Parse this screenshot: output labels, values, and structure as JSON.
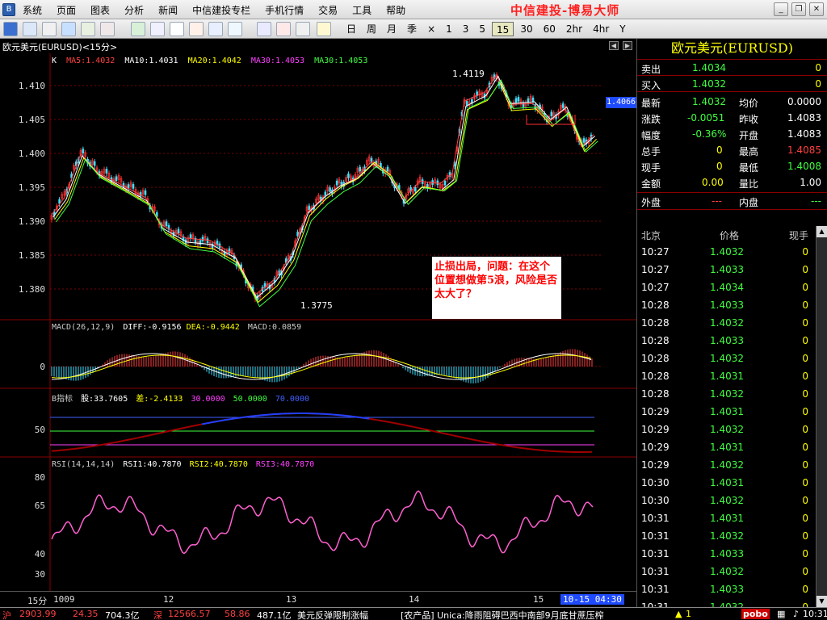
{
  "menu": {
    "items": [
      "系统",
      "页面",
      "图表",
      "分析",
      "新闻",
      "中信建投专栏",
      "手机行情",
      "交易",
      "工具",
      "帮助"
    ],
    "brand": "中信建投-博易大师"
  },
  "toolbar": {
    "periods": [
      "日",
      "周",
      "月",
      "季",
      "×",
      "1",
      "3",
      "5",
      "15",
      "30",
      "60",
      "2hr",
      "4hr",
      "Y"
    ],
    "active_period": "15"
  },
  "chart": {
    "title": "欧元美元(EURUSD)<15分>",
    "price_pane": {
      "legend": [
        {
          "text": "K",
          "color": "#ffffff"
        },
        {
          "text": "MA5:1.4032",
          "color": "#ff4040"
        },
        {
          "text": "MA10:1.4031",
          "color": "#ffffff"
        },
        {
          "text": "MA20:1.4042",
          "color": "#ffff00"
        },
        {
          "text": "MA30:1.4053",
          "color": "#ff40ff"
        },
        {
          "text": "MA30:1.4053",
          "color": "#40ff40"
        }
      ],
      "y_ticks": [
        "1.410",
        "1.405",
        "1.400",
        "1.395",
        "1.390",
        "1.385",
        "1.380"
      ],
      "high_label": "1.4119",
      "low_label": "1.3775",
      "last_price_tag": "1.4066"
    },
    "macd_pane": {
      "legend": [
        {
          "text": "MACD(26,12,9)",
          "color": "#cccccc"
        },
        {
          "text": "DIFF:-0.9156",
          "color": "#ffffff"
        },
        {
          "text": "DEA:-0.9442",
          "color": "#ffff00"
        },
        {
          "text": "MACD:0.0859",
          "color": "#cccccc"
        }
      ],
      "y_ticks": [
        "0"
      ]
    },
    "b_pane": {
      "legend": [
        {
          "text": "B指标",
          "color": "#cccccc"
        },
        {
          "text": "股:33.7605",
          "color": "#ffffff"
        },
        {
          "text": "差:-2.4133",
          "color": "#ffff00"
        },
        {
          "text": "30.0000",
          "color": "#ff40ff"
        },
        {
          "text": "50.0000",
          "color": "#40ff40"
        },
        {
          "text": "70.0000",
          "color": "#4060ff"
        }
      ],
      "y_ticks": [
        "50"
      ]
    },
    "rsi_pane": {
      "legend": [
        {
          "text": "RSI(14,14,14)",
          "color": "#cccccc"
        },
        {
          "text": "RSI1:40.7870",
          "color": "#ffffff"
        },
        {
          "text": "RSI2:40.7870",
          "color": "#ffff00"
        },
        {
          "text": "RSI3:40.7870",
          "color": "#ff40ff"
        }
      ],
      "y_ticks": [
        "80",
        "65",
        "40",
        "30"
      ]
    },
    "note": "止损出局，问题：在这个位置想做第5浪，风险是否太大了？",
    "x_axis": {
      "period_label": "15分",
      "labels": [
        "1009",
        "12",
        "13",
        "14",
        "15"
      ],
      "time_tag": "10-15 04:30"
    }
  },
  "quote": {
    "title": "欧元美元(EURUSD)",
    "sell": {
      "label": "卖出",
      "price": "1.4034",
      "qty": "0"
    },
    "buy": {
      "label": "买入",
      "price": "1.4032",
      "qty": "0"
    },
    "stats": [
      {
        "l1": "最新",
        "v1": "1.4032",
        "c1": "#40ff40",
        "l2": "均价",
        "v2": "0.0000",
        "c2": "#ffffff"
      },
      {
        "l1": "涨跌",
        "v1": "-0.0051",
        "c1": "#40ff40",
        "l2": "昨收",
        "v2": "1.4083",
        "c2": "#ffffff"
      },
      {
        "l1": "幅度",
        "v1": "-0.36%",
        "c1": "#40ff40",
        "l2": "开盘",
        "v2": "1.4083",
        "c2": "#ffffff"
      },
      {
        "l1": "总手",
        "v1": "0",
        "c1": "#ffff00",
        "l2": "最高",
        "v2": "1.4085",
        "c2": "#ff4040"
      },
      {
        "l1": "现手",
        "v1": "0",
        "c1": "#ffff00",
        "l2": "最低",
        "v2": "1.4008",
        "c2": "#40ff40"
      },
      {
        "l1": "金额",
        "v1": "0.00",
        "c1": "#ffff00",
        "l2": "量比",
        "v2": "1.00",
        "c2": "#ffffff"
      }
    ],
    "outer": {
      "label": "外盘",
      "value": "---"
    },
    "inner": {
      "label": "内盘",
      "value": "---"
    },
    "trades_header": {
      "time": "北京",
      "price": "价格",
      "qty": "现手"
    },
    "trades": [
      {
        "time": "10:27",
        "price": "1.4032",
        "qty": "0"
      },
      {
        "time": "10:27",
        "price": "1.4033",
        "qty": "0"
      },
      {
        "time": "10:27",
        "price": "1.4034",
        "qty": "0"
      },
      {
        "time": "10:28",
        "price": "1.4033",
        "qty": "0"
      },
      {
        "time": "10:28",
        "price": "1.4032",
        "qty": "0"
      },
      {
        "time": "10:28",
        "price": "1.4033",
        "qty": "0"
      },
      {
        "time": "10:28",
        "price": "1.4032",
        "qty": "0"
      },
      {
        "time": "10:28",
        "price": "1.4031",
        "qty": "0"
      },
      {
        "time": "10:28",
        "price": "1.4032",
        "qty": "0"
      },
      {
        "time": "10:29",
        "price": "1.4031",
        "qty": "0"
      },
      {
        "time": "10:29",
        "price": "1.4032",
        "qty": "0"
      },
      {
        "time": "10:29",
        "price": "1.4031",
        "qty": "0"
      },
      {
        "time": "10:29",
        "price": "1.4032",
        "qty": "0"
      },
      {
        "time": "10:30",
        "price": "1.4031",
        "qty": "0"
      },
      {
        "time": "10:30",
        "price": "1.4032",
        "qty": "0"
      },
      {
        "time": "10:31",
        "price": "1.4031",
        "qty": "0"
      },
      {
        "time": "10:31",
        "price": "1.4032",
        "qty": "0"
      },
      {
        "time": "10:31",
        "price": "1.4033",
        "qty": "0"
      },
      {
        "time": "10:31",
        "price": "1.4032",
        "qty": "0"
      },
      {
        "time": "10:31",
        "price": "1.4033",
        "qty": "0"
      },
      {
        "time": "10:31",
        "price": "1.4032",
        "qty": "0"
      }
    ]
  },
  "status": {
    "sh_label": "沪",
    "sh_index": "2903.99",
    "sh_change": "24.35",
    "sh_amount": "704.3亿",
    "sz_label": "深",
    "sz_index": "12566.57",
    "sz_change": "58.86",
    "sz_amount": "487.1亿",
    "news1": "美元反弹限制涨幅",
    "news2": "[农产品] Unica:降雨阻碍巴西中南部9月底甘蔗压榨",
    "alert": "1",
    "logo": "pobo",
    "clock": "10:31"
  }
}
